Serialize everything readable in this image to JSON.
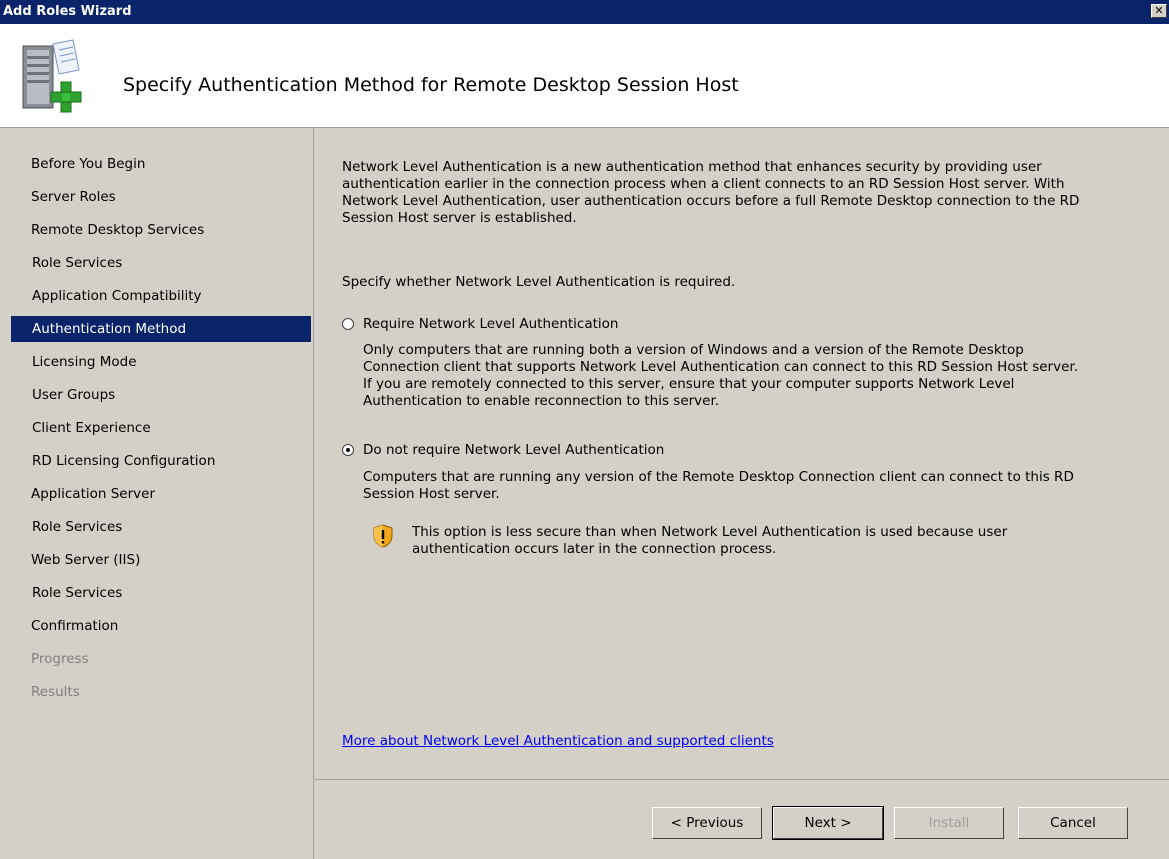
{
  "window": {
    "title": "Add Roles Wizard",
    "close_glyph": "✕"
  },
  "header": {
    "title": "Specify Authentication Method for Remote Desktop Session Host",
    "icon": "server-add-icon"
  },
  "nav": {
    "items": [
      {
        "label": "Before You Begin",
        "level": "top",
        "state": "normal"
      },
      {
        "label": "Server Roles",
        "level": "top",
        "state": "normal"
      },
      {
        "label": "Remote Desktop Services",
        "level": "top",
        "state": "normal"
      },
      {
        "label": "Role Services",
        "level": "sub",
        "state": "normal"
      },
      {
        "label": "Application Compatibility",
        "level": "sub",
        "state": "normal"
      },
      {
        "label": "Authentication Method",
        "level": "sub",
        "state": "selected"
      },
      {
        "label": "Licensing Mode",
        "level": "sub",
        "state": "normal"
      },
      {
        "label": "User Groups",
        "level": "sub",
        "state": "normal"
      },
      {
        "label": "Client Experience",
        "level": "sub",
        "state": "normal"
      },
      {
        "label": "RD Licensing Configuration",
        "level": "sub",
        "state": "normal"
      },
      {
        "label": "Application Server",
        "level": "top",
        "state": "normal"
      },
      {
        "label": "Role Services",
        "level": "sub",
        "state": "normal"
      },
      {
        "label": "Web Server (IIS)",
        "level": "top",
        "state": "normal"
      },
      {
        "label": "Role Services",
        "level": "sub",
        "state": "normal"
      },
      {
        "label": "Confirmation",
        "level": "top",
        "state": "normal"
      },
      {
        "label": "Progress",
        "level": "top",
        "state": "disabled"
      },
      {
        "label": "Results",
        "level": "top",
        "state": "disabled"
      }
    ]
  },
  "content": {
    "intro_lines": [
      "Network Level Authentication is a new authentication method that enhances security by providing user",
      "authentication earlier in the connection process when a client connects to an RD Session Host server. With",
      "Network Level Authentication, user authentication occurs before a full Remote Desktop connection to the RD",
      "Session Host server is established."
    ],
    "prompt": "Specify whether Network Level Authentication is required.",
    "option1": {
      "label": "Require Network Level Authentication",
      "checked": false,
      "desc_lines": [
        "Only computers that are running both a version of Windows and a version of the Remote Desktop",
        "Connection client that supports Network Level Authentication can connect to this RD Session Host server.",
        "If you are remotely connected to this server, ensure that your computer supports Network Level",
        "Authentication to enable reconnection to this server."
      ]
    },
    "option2": {
      "label": "Do not require Network Level Authentication",
      "checked": true,
      "desc_lines": [
        "Computers that are running any version of the Remote Desktop Connection client can connect to this RD",
        "Session Host server."
      ]
    },
    "warning": {
      "icon": "shield-warning-icon",
      "lines": [
        "This option is less secure than when Network Level Authentication is used because user",
        "authentication occurs later in the connection process."
      ]
    },
    "link": "More about Network Level Authentication and supported clients"
  },
  "buttons": {
    "previous": "< Previous",
    "next": "Next >",
    "install": "Install",
    "cancel": "Cancel"
  },
  "colors": {
    "title_bar": "#0a246a",
    "selection": "#0a246a",
    "face": "#d4d0c8",
    "link": "#0000ee"
  }
}
